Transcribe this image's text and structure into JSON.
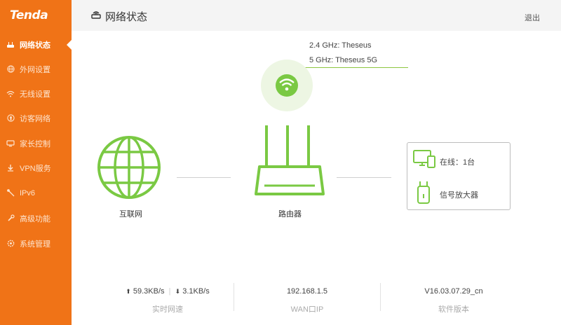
{
  "brand": {
    "logo": "Tenda",
    "accent": "#f07317",
    "green": "#7ac943"
  },
  "sidebar": {
    "items": [
      {
        "label": "网络状态",
        "icon": "router-icon",
        "active": true
      },
      {
        "label": "外网设置",
        "icon": "globe-icon"
      },
      {
        "label": "无线设置",
        "icon": "wifi-icon"
      },
      {
        "label": "访客网络",
        "icon": "guest-icon"
      },
      {
        "label": "家长控制",
        "icon": "parental-icon"
      },
      {
        "label": "VPN服务",
        "icon": "vpn-icon"
      },
      {
        "label": "IPv6",
        "icon": "ipv6-icon"
      },
      {
        "label": "高级功能",
        "icon": "wrench-icon"
      },
      {
        "label": "系统管理",
        "icon": "gear-icon"
      }
    ]
  },
  "header": {
    "title": "网络状态",
    "logout": "退出"
  },
  "wifi": {
    "ssid_24": "2.4 GHz: Theseus",
    "ssid_5": "5 GHz: Theseus 5G"
  },
  "topology": {
    "internet_label": "互联网",
    "router_label": "路由器"
  },
  "devices": {
    "online": "在线：1台",
    "extender": "信号放大器"
  },
  "stats": {
    "upload": "59.3KB/s",
    "download": "3.1KB/s",
    "speed_label": "实时网速",
    "wan_ip": "192.168.1.5",
    "wan_label": "WAN口IP",
    "firmware": "V16.03.07.29_cn",
    "firmware_label": "软件版本"
  }
}
